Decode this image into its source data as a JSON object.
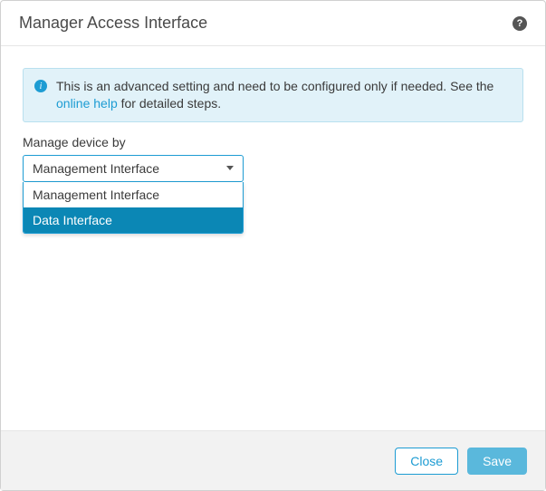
{
  "header": {
    "title": "Manager Access Interface"
  },
  "info": {
    "text_before_link": "This is an advanced setting and need to be configured only if needed. See the ",
    "link": "online help",
    "text_after_link": " for detailed steps."
  },
  "field": {
    "label": "Manage device by",
    "selected": "Management Interface",
    "options": [
      "Management Interface",
      "Data Interface"
    ]
  },
  "footer": {
    "close": "Close",
    "save": "Save"
  }
}
